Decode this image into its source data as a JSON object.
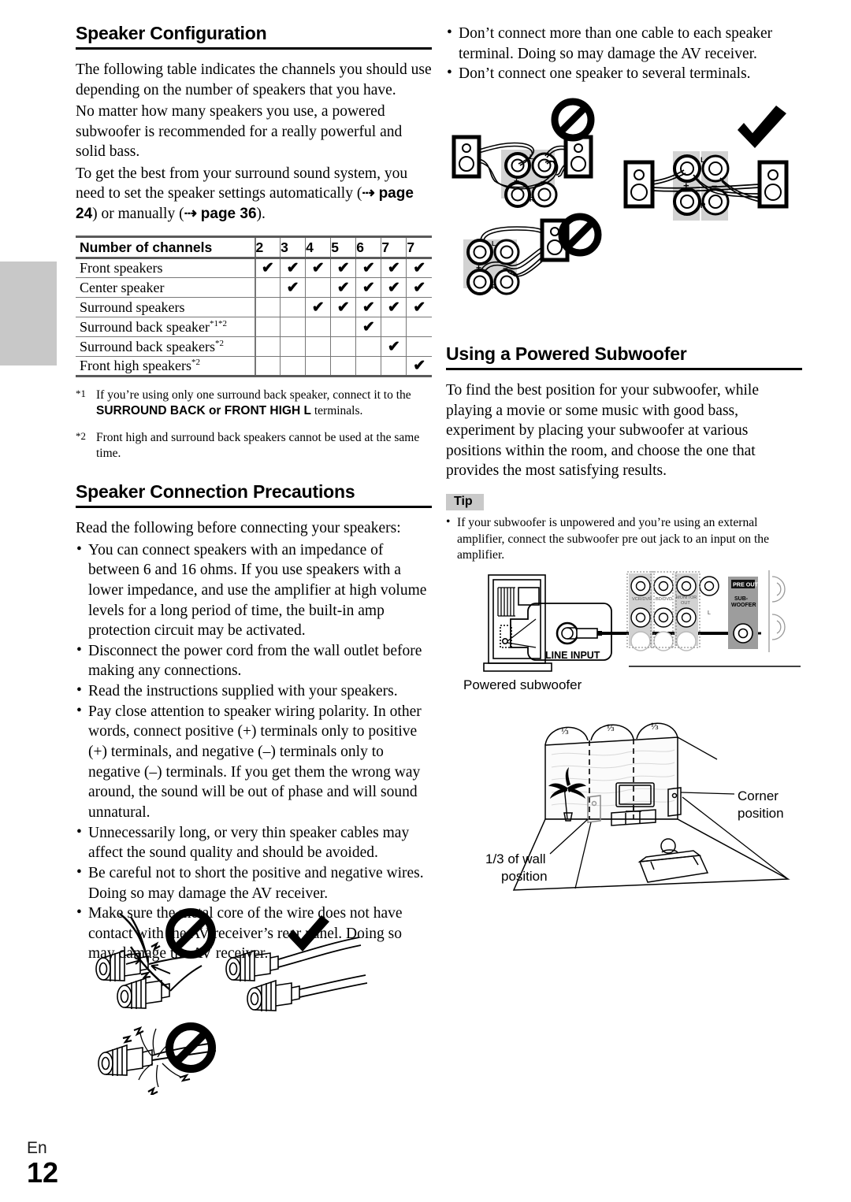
{
  "page": {
    "language": "En",
    "number": "12"
  },
  "left_column": {
    "section1": {
      "heading": "Speaker Configuration",
      "paragraphs": [
        "The following table indicates the channels you should use depending on the number of speakers that you have.",
        "No matter how many speakers you use, a powered subwoofer is recommended for a really powerful and solid bass."
      ],
      "para_with_links": {
        "before": "To get the best from your surround sound system, you need to set the speaker settings automatically (",
        "arrow1": "⇢",
        "link1": "page 24",
        "middle": ") or manually (",
        "arrow2": "⇢",
        "link2": "page 36",
        "after": ")."
      },
      "table": {
        "row_header": "Number of channels",
        "columns": [
          "2",
          "3",
          "4",
          "5",
          "6",
          "7",
          "7"
        ],
        "check_glyph": "✔",
        "rows": [
          {
            "label": "Front speakers",
            "sup": "",
            "checks": [
              true,
              true,
              true,
              true,
              true,
              true,
              true
            ]
          },
          {
            "label": "Center speaker",
            "sup": "",
            "checks": [
              false,
              true,
              false,
              true,
              true,
              true,
              true
            ]
          },
          {
            "label": "Surround speakers",
            "sup": "",
            "checks": [
              false,
              false,
              true,
              true,
              true,
              true,
              true
            ]
          },
          {
            "label": "Surround back speaker",
            "sup": "*1*2",
            "checks": [
              false,
              false,
              false,
              false,
              true,
              false,
              false
            ]
          },
          {
            "label": "Surround back speakers",
            "sup": "*2",
            "checks": [
              false,
              false,
              false,
              false,
              false,
              true,
              false
            ]
          },
          {
            "label": "Front high speakers",
            "sup": "*2",
            "checks": [
              false,
              false,
              false,
              false,
              false,
              false,
              true
            ]
          }
        ]
      },
      "footnotes": [
        {
          "marker": "*1",
          "before": "If you’re using only one surround back speaker, connect it to the ",
          "bold": "SURROUND BACK or FRONT HIGH L",
          "after": " terminals."
        },
        {
          "marker": "*2",
          "before": "Front high and surround back speakers cannot be used at the same time.",
          "bold": "",
          "after": ""
        }
      ]
    },
    "section2": {
      "heading": "Speaker Connection Precautions",
      "intro": "Read the following before connecting your speakers:",
      "bullets": [
        "You can connect speakers with an impedance of between 6 and 16 ohms. If you use speakers with a lower impedance, and use the amplifier at high volume levels for a long period of time, the built-in amp protection circuit may be activated.",
        "Disconnect the power cord from the wall outlet before making any connections.",
        "Read the instructions supplied with your speakers.",
        "Pay close attention to speaker wiring polarity. In other words, connect positive (+) terminals only to positive (+) terminals, and negative (–) terminals only to negative (–) terminals. If you get them the wrong way around, the sound will be out of phase and will sound unnatural.",
        "Unnecessarily long, or very thin speaker cables may affect the sound quality and should be avoided.",
        "Be careful not to short the positive and negative wires. Doing so may damage the AV receiver.",
        "Make sure the metal core of the wire does not have contact with the AV receiver’s rear panel. Doing so may damage the AV receiver."
      ]
    },
    "figure_terminals": {
      "name": "speaker-terminal-wire-figure",
      "items": [
        {
          "id": "bare-wires-touching",
          "badge": "prohibited"
        },
        {
          "id": "wire-inserted-correctly",
          "badge": "allowed"
        },
        {
          "id": "frayed-wire-strands",
          "badge": "prohibited"
        }
      ]
    }
  },
  "right_column": {
    "top_bullets": [
      "Don’t connect more than one cable to each speaker terminal. Doing so may damage the AV receiver.",
      "Don’t connect one speaker to several terminals."
    ],
    "figure_connections": {
      "name": "speaker-connection-figure",
      "terminal_labels": {
        "left": "L",
        "right": "R",
        "plus": "+",
        "minus": "–"
      },
      "items": [
        {
          "id": "two-cables-one-terminal",
          "badge": "prohibited"
        },
        {
          "id": "one-speaker-several-terminals",
          "badge": "prohibited"
        },
        {
          "id": "correct-one-cable-per-terminal",
          "badge": "allowed"
        }
      ]
    },
    "section3": {
      "heading": "Using a Powered Subwoofer",
      "paragraph": "To find the best position for your subwoofer, while playing a movie or some music with good bass, experiment by placing your subwoofer at various positions within the room, and choose the one that provides the most satisfying results.",
      "tip_label": "Tip",
      "tip_bullets": [
        "If your subwoofer is unpowered and you’re using an external amplifier, connect the subwoofer pre out jack to an input on the amplifier."
      ]
    },
    "figure_subwoofer": {
      "name": "subwoofer-hookup-figure",
      "caption": "Powered subwoofer",
      "callout": "LINE INPUT",
      "rear_panel_labels": [
        "VCR/DVR",
        "BD/DVD",
        "MONITOR OUT"
      ],
      "preout_label": "PRE OUT",
      "subwoofer_jack_label": "SUB-WOOFER"
    },
    "figure_room": {
      "name": "subwoofer-placement-room-figure",
      "wall_fractions": [
        "⅓",
        "⅓",
        "⅓"
      ],
      "labels": {
        "corner": "Corner\nposition",
        "corner_line1": "Corner",
        "corner_line2": "position",
        "third_line1": "1/3 of wall",
        "third_line2": "position"
      }
    }
  }
}
